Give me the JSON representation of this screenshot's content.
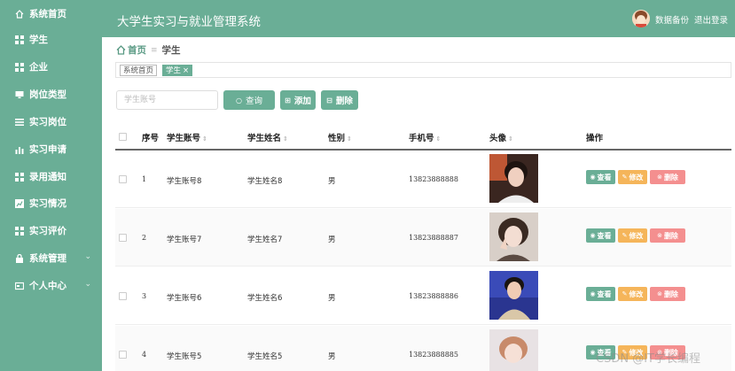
{
  "app": {
    "title": "大学生实习与就业管理系统"
  },
  "header": {
    "user_name": "数据备份",
    "logout": "退出登录"
  },
  "sidebar": {
    "items": [
      {
        "label": "系统首页",
        "icon": "home-icon"
      },
      {
        "label": "学生",
        "icon": "grid-icon"
      },
      {
        "label": "企业",
        "icon": "grid-icon"
      },
      {
        "label": "岗位类型",
        "icon": "monitor-icon"
      },
      {
        "label": "实习岗位",
        "icon": "list-icon"
      },
      {
        "label": "实习申请",
        "icon": "bar-chart-icon"
      },
      {
        "label": "录用通知",
        "icon": "grid-icon"
      },
      {
        "label": "实习情况",
        "icon": "chart-icon"
      },
      {
        "label": "实习评价",
        "icon": "grid-icon"
      },
      {
        "label": "系统管理",
        "icon": "lock-icon"
      },
      {
        "label": "个人中心",
        "icon": "card-icon"
      }
    ]
  },
  "breadcrumb": {
    "home": "首页",
    "current": "学生"
  },
  "tabs": [
    {
      "label": "系统首页"
    },
    {
      "label": "学生"
    }
  ],
  "search": {
    "placeholder": "学生账号",
    "value": ""
  },
  "toolbar": {
    "query": "查询",
    "add": "添加",
    "delete": "删除"
  },
  "table": {
    "columns": [
      "序号",
      "学生账号",
      "学生姓名",
      "性别",
      "手机号",
      "头像",
      "操作"
    ],
    "rows": [
      {
        "index": "1",
        "account": "学生账号8",
        "name": "学生姓名8",
        "gender": "男",
        "phone": "13823888888"
      },
      {
        "index": "2",
        "account": "学生账号7",
        "name": "学生姓名7",
        "gender": "男",
        "phone": "13823888887"
      },
      {
        "index": "3",
        "account": "学生账号6",
        "name": "学生姓名6",
        "gender": "男",
        "phone": "13823888886"
      },
      {
        "index": "4",
        "account": "学生账号5",
        "name": "学生姓名5",
        "gender": "男",
        "phone": "13823888885"
      }
    ],
    "actions": {
      "view": "查看",
      "edit": "修改",
      "delete": "删除"
    }
  },
  "watermark": "CSDN @IT学长编程",
  "colors": {
    "primary": "#6aae96",
    "edit": "#f5b55a",
    "danger": "#f48f8f"
  }
}
